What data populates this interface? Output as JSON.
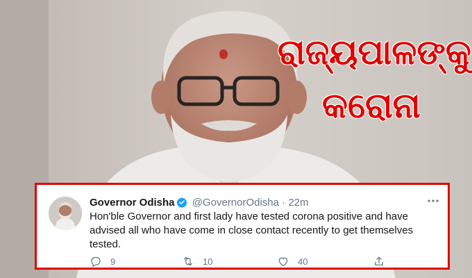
{
  "headline": {
    "line1": "ରାଜ୍ୟପାଳଙ୍କୁ",
    "line2": "କରୋନା",
    "color": "#e00000"
  },
  "tweet": {
    "display_name": "Governor Odisha",
    "handle": "@GovernorOdisha",
    "separator": "·",
    "time": "22m",
    "text": "Hon'ble Governor and first lady have tested corona positive and have advised all who have come in close contact recently to get themselves tested.",
    "border_color": "#e10000",
    "verified_color": "#1da1f2",
    "actions": {
      "reply_icon": "reply-icon",
      "reply_count": "9",
      "retweet_icon": "retweet-icon",
      "retweet_count": "10",
      "like_icon": "like-icon",
      "like_count": "40",
      "share_icon": "share-icon"
    }
  }
}
